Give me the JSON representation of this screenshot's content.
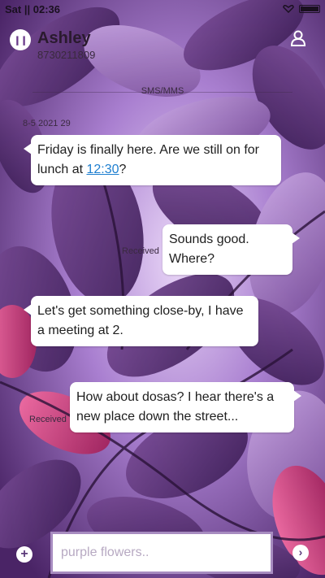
{
  "status_bar": {
    "time": "Sat || 02:36"
  },
  "header": {
    "contact_name": "Ashley",
    "contact_number": "8730211809"
  },
  "thread": {
    "divider_label": "SMS/MMS",
    "timestamp": "8-5 2021 29",
    "messages": [
      {
        "direction": "in",
        "text_before_link": "Friday is finally here. Are we still on for lunch at ",
        "link": "12:30",
        "text_after_link": "?"
      },
      {
        "direction": "out",
        "text": "Sounds good. Where?",
        "status": "Received"
      },
      {
        "direction": "in",
        "text": "Let's get something close-by, I have a meeting at 2."
      },
      {
        "direction": "out",
        "text": "How about dosas? I hear there's a new place down the street...",
        "status": "Received"
      }
    ]
  },
  "composer": {
    "input_value": "",
    "input_placeholder": "purple flowers..",
    "add_icon": "plus-icon",
    "send_icon": "chevron-right-icon"
  },
  "colors": {
    "accent": "#a78cc0",
    "link": "#1e7fd0",
    "bubble": "#ffffff"
  }
}
